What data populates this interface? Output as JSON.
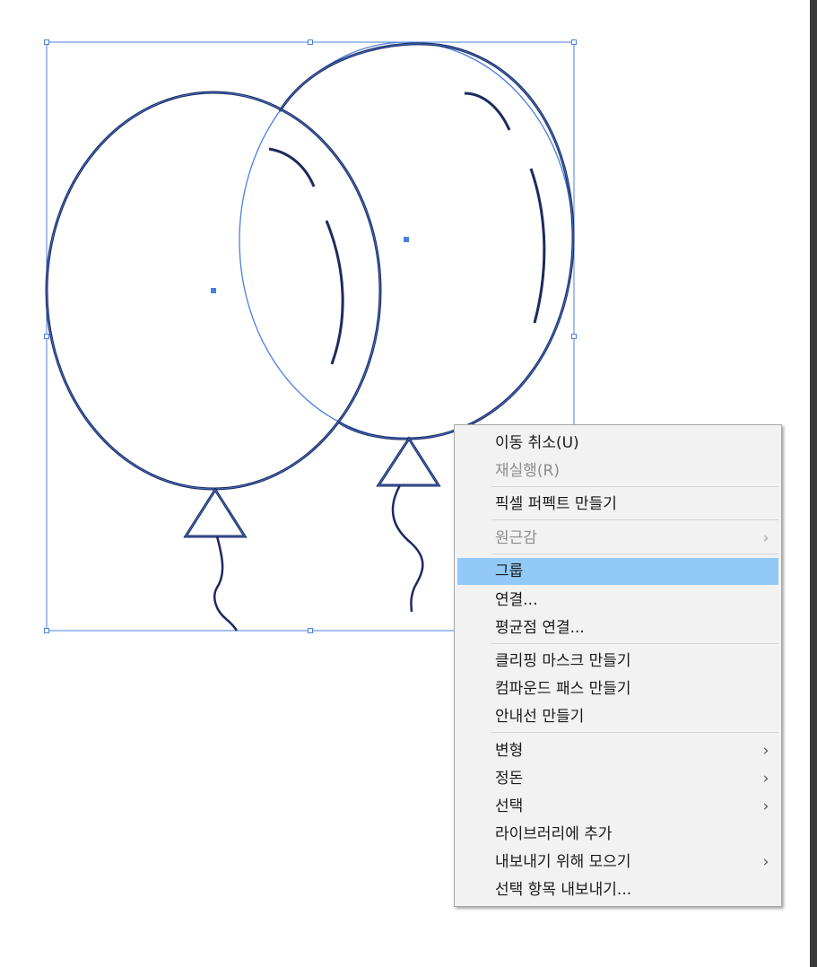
{
  "context_menu": {
    "items": [
      {
        "label": "이동 취소(U)",
        "enabled": true,
        "submenu": false
      },
      {
        "label": "재실행(R)",
        "enabled": false,
        "submenu": false
      },
      {
        "label": "픽셀 퍼펙트 만들기",
        "enabled": true,
        "submenu": false
      },
      {
        "label": "원근감",
        "enabled": false,
        "submenu": true
      },
      {
        "label": "그룹",
        "enabled": true,
        "submenu": false,
        "highlighted": true
      },
      {
        "label": "연결...",
        "enabled": true,
        "submenu": false
      },
      {
        "label": "평균점 연결...",
        "enabled": true,
        "submenu": false
      },
      {
        "label": "클리핑 마스크 만들기",
        "enabled": true,
        "submenu": false
      },
      {
        "label": "컴파운드 패스 만들기",
        "enabled": true,
        "submenu": false
      },
      {
        "label": "안내선 만들기",
        "enabled": true,
        "submenu": false
      },
      {
        "label": "변형",
        "enabled": true,
        "submenu": true
      },
      {
        "label": "정돈",
        "enabled": true,
        "submenu": true
      },
      {
        "label": "선택",
        "enabled": true,
        "submenu": true
      },
      {
        "label": "라이브러리에 추가",
        "enabled": true,
        "submenu": false
      },
      {
        "label": "내보내기 위해 모으기",
        "enabled": true,
        "submenu": true
      },
      {
        "label": "선택 항목 내보내기...",
        "enabled": true,
        "submenu": false
      }
    ],
    "submenu_glyph": "›"
  },
  "colors": {
    "selection": "#4a7fe0",
    "stroke": "#1d2a5c",
    "highlight": "#91c9f7",
    "menu_bg": "#f2f2f2"
  },
  "icons": {
    "submenu_arrow": "chevron-right-icon"
  }
}
